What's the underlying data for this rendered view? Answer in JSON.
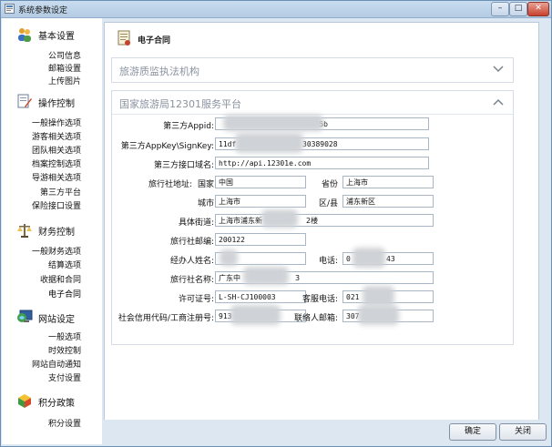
{
  "window": {
    "title": "系统参数设定",
    "controls": [
      "–",
      "□",
      "✕"
    ]
  },
  "sidebar": {
    "sections": [
      {
        "title": "基本设置",
        "icon": "users-icon",
        "items": [
          "公司信息",
          "邮箱设置",
          "上传图片"
        ]
      },
      {
        "title": "操作控制",
        "icon": "document-edit-icon",
        "items": [
          "一般操作选项",
          "游客相关选项",
          "团队相关选项",
          "档案控制选项",
          "导游相关选项",
          "第三方平台",
          "保险接口设置"
        ]
      },
      {
        "title": "财务控制",
        "icon": "scales-icon",
        "items": [
          "一般财务选项",
          "结算选项",
          "收据和合同",
          "电子合同"
        ]
      },
      {
        "title": "网站设定",
        "icon": "globe-monitor-icon",
        "items": [
          "一般选项",
          "时效控制",
          "网站自动通知",
          "支付设置"
        ]
      },
      {
        "title": "积分政策",
        "icon": "gift-box-icon",
        "items": [
          "积分设置"
        ]
      }
    ],
    "active_item": "电子合同"
  },
  "main": {
    "header_title": "电子合同",
    "collapsed_panel_title": "旅游质监执法机构",
    "expanded_panel_title": "国家旅游局12301服务平台",
    "fields": {
      "appid_label": "第三方Appid:",
      "appid_value": "5b",
      "appkey_label": "第三方AppKey\\SignKey:",
      "appkey_value_start": "11df",
      "appkey_value_end": "30389028",
      "api_label": "第三方接口域名:",
      "api_value": "http://api.12301e.com",
      "addr_label": "旅行社地址:",
      "country_label": "国家",
      "country_value": "中国",
      "province_label": "省份",
      "province_value": "上海市",
      "city_label": "城市",
      "city_value": "上海市",
      "district_label": "区/县",
      "district_value": "浦东新区",
      "street_label": "具体街道:",
      "street_value_start": "上海市浦东新",
      "street_value_end": "2楼",
      "postcode_label": "旅行社邮编:",
      "postcode_value": "200122",
      "agent_label": "经办人姓名:",
      "phone_label": "电话:",
      "phone_value_start": "0",
      "phone_value_end": "43",
      "agency_label": "旅行社名称:",
      "agency_value_start": "广东中",
      "agency_value_end": "3",
      "license_label": "许可证号:",
      "license_value": "L-SH-CJ100003",
      "service_phone_label": "客服电话:",
      "service_phone_value": "021",
      "credit_label": "社会信用代码/工商注册号:",
      "credit_value": "913",
      "email_label": "联络人邮箱:",
      "email_value": "307"
    }
  },
  "footer": {
    "ok_label": "确定",
    "close_label": "关闭"
  },
  "colors": {
    "window_border": "#6b8fb5",
    "titlebar": "#b3cbe3",
    "close_button": "#c8412d",
    "panel_title": "#8a93a0"
  }
}
